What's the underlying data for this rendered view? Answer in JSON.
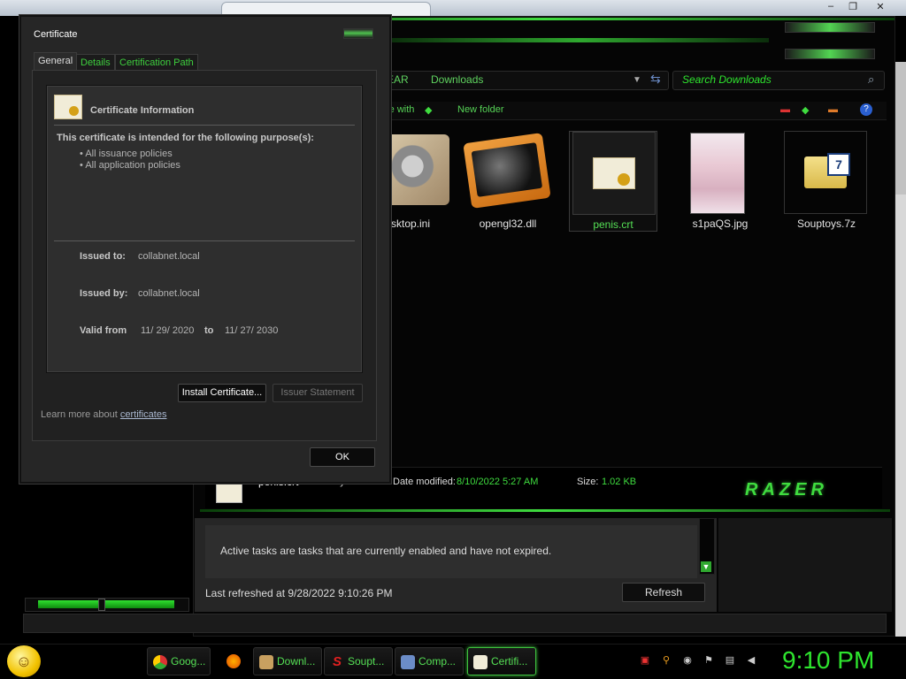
{
  "browser": {
    "win_min": "–",
    "win_max": "❐",
    "win_close": "✕"
  },
  "explorer": {
    "breadcrumb_partial": "EAR",
    "breadcrumb_current": "Downloads",
    "search_placeholder": "Search Downloads",
    "toolbar_share": "re with",
    "toolbar_new_folder": "New folder",
    "files": [
      {
        "name": "sktop.ini",
        "icon": "gear-icon"
      },
      {
        "name": "opengl32.dll",
        "icon": "dll-icon"
      },
      {
        "name": "penis.crt",
        "icon": "certificate-icon",
        "selected": true
      },
      {
        "name": "s1paQS.jpg",
        "icon": "image-thumbnail-icon"
      },
      {
        "name": "Souptoys.7z",
        "icon": "archive-icon"
      }
    ],
    "details": {
      "file": "penis.crt",
      "type": "Security Certificate",
      "date_label": "Date modified:",
      "date_value": "8/10/2022 5:27 AM",
      "size_label": "Size:",
      "size_value": "1.02 KB",
      "brand": "RAZER"
    }
  },
  "tasks": {
    "description": "Active tasks are tasks that are currently enabled and have not expired.",
    "last_refreshed": "Last refreshed at 9/28/2022 9:10:26 PM",
    "refresh_label": "Refresh"
  },
  "certificate": {
    "title": "Certificate",
    "tabs": [
      "General",
      "Details",
      "Certification Path"
    ],
    "heading": "Certificate Information",
    "purpose_label": "This certificate is intended for the following purpose(s):",
    "purposes": [
      "All issuance policies",
      "All application policies"
    ],
    "issued_to_label": "Issued to:",
    "issued_to": "collabnet.local",
    "issued_by_label": "Issued by:",
    "issued_by": "collabnet.local",
    "valid_from_label": "Valid from",
    "valid_from": "11/ 29/ 2020",
    "valid_to_label": "to",
    "valid_to": "11/ 27/ 2030",
    "install_label": "Install Certificate...",
    "issuer_statement_label": "Issuer Statement",
    "learn_more": "Learn more about",
    "learn_more_link": "certificates",
    "ok_label": "OK"
  },
  "taskbar": {
    "items": [
      {
        "label": "Goog...",
        "icon": "chrome-icon"
      },
      {
        "label": "Downl...",
        "icon": "explorer-icon"
      },
      {
        "label": "Soupt...",
        "icon": "souptoys-icon"
      },
      {
        "label": "Comp...",
        "icon": "computer-management-icon"
      },
      {
        "label": "Certifi...",
        "icon": "certificate-icon",
        "active": true
      }
    ],
    "clock": "9:10 PM"
  },
  "colors": {
    "accent": "#3fdc3f",
    "panel": "#262626"
  }
}
